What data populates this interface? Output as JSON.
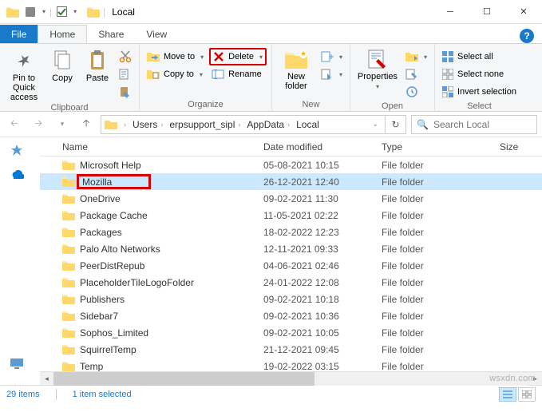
{
  "window": {
    "title": "Local"
  },
  "tabs": {
    "file": "File",
    "home": "Home",
    "share": "Share",
    "view": "View"
  },
  "ribbon": {
    "clipboard": {
      "label": "Clipboard",
      "pin": "Pin to Quick\naccess",
      "copy": "Copy",
      "paste": "Paste"
    },
    "organize": {
      "label": "Organize",
      "moveto": "Move to",
      "copyto": "Copy to",
      "delete": "Delete",
      "rename": "Rename"
    },
    "new": {
      "label": "New",
      "newfolder": "New\nfolder"
    },
    "open": {
      "label": "Open",
      "properties": "Properties"
    },
    "select": {
      "label": "Select",
      "selectall": "Select all",
      "selectnone": "Select none",
      "invert": "Invert selection"
    }
  },
  "breadcrumbs": [
    "Users",
    "erpsupport_sipl",
    "AppData",
    "Local"
  ],
  "search": {
    "placeholder": "Search Local"
  },
  "columns": {
    "name": "Name",
    "date": "Date modified",
    "type": "Type",
    "size": "Size"
  },
  "type_label": "File folder",
  "items": [
    {
      "name": "Microsoft Help",
      "date": "05-08-2021 10:15"
    },
    {
      "name": "Mozilla",
      "date": "26-12-2021 12:40",
      "selected": true,
      "highlight": true
    },
    {
      "name": "OneDrive",
      "date": "09-02-2021 11:30"
    },
    {
      "name": "Package Cache",
      "date": "11-05-2021 02:22"
    },
    {
      "name": "Packages",
      "date": "18-02-2022 12:23"
    },
    {
      "name": "Palo Alto Networks",
      "date": "12-11-2021 09:33"
    },
    {
      "name": "PeerDistRepub",
      "date": "04-06-2021 02:46"
    },
    {
      "name": "PlaceholderTileLogoFolder",
      "date": "24-01-2022 12:08"
    },
    {
      "name": "Publishers",
      "date": "09-02-2021 10:18"
    },
    {
      "name": "Sidebar7",
      "date": "09-02-2021 10:36"
    },
    {
      "name": "Sophos_Limited",
      "date": "09-02-2021 10:05"
    },
    {
      "name": "SquirrelTemp",
      "date": "21-12-2021 09:45"
    },
    {
      "name": "Temp",
      "date": "19-02-2022 03:15"
    }
  ],
  "status": {
    "count": "29 items",
    "selected": "1 item selected"
  },
  "watermark": "wsxdn.com"
}
